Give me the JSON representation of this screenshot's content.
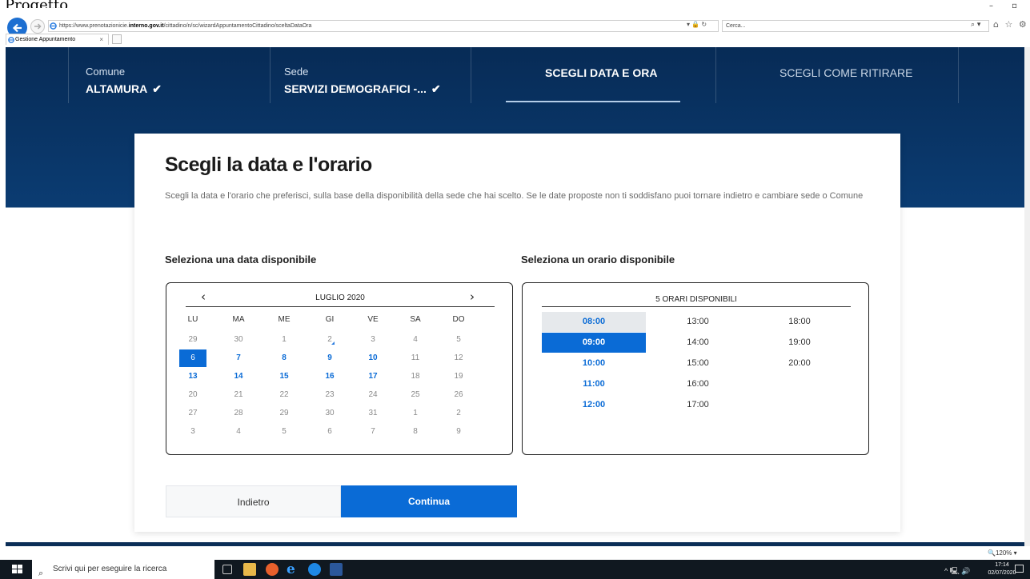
{
  "browser": {
    "top_text": "Progetto",
    "url_prefix": "https://www.prenotazionicie.",
    "url_domain": "interno.gov.it",
    "url_rest": "/cittadino/n/sc/wizardAppuntamentoCittadino/sceltaDataOra",
    "addr_icons": "▾ 🔒 ↻",
    "search_placeholder": "Cerca...",
    "search_icon_glyph": "⌕ ▾",
    "toolbar_glyphs": "⌂ ☆ ⚙ ☺",
    "window_controls": "– ▫ ×",
    "tab_title": "Gestione Appuntamento",
    "tab_close": "×"
  },
  "steps": {
    "comune_label": "Comune",
    "comune_value": "ALTAMURA",
    "sede_label": "Sede",
    "sede_value": "SERVIZI DEMOGRAFICI -...",
    "check": "✔",
    "active": "SCEGLI DATA E ORA",
    "next": "SCEGLI COME RITIRARE"
  },
  "card": {
    "title": "Scegli la data e l'orario",
    "description": "Scegli la data e l'orario che preferisci, sulla base della disponibilità della sede che hai scelto. Se le date proposte non ti soddisfano puoi tornare indietro e cambiare sede o Comune",
    "date_heading": "Seleziona una data disponibile",
    "time_heading": "Seleziona un orario disponibile"
  },
  "calendar": {
    "month": "LUGLIO 2020",
    "prev": "‹",
    "next": "›",
    "weekdays": [
      "LU",
      "MA",
      "ME",
      "GI",
      "VE",
      "SA",
      "DO"
    ],
    "weeks": [
      [
        "29",
        "30",
        "1",
        "2",
        "3",
        "4",
        "5"
      ],
      [
        "6",
        "7",
        "8",
        "9",
        "10",
        "11",
        "12"
      ],
      [
        "13",
        "14",
        "15",
        "16",
        "17",
        "18",
        "19"
      ],
      [
        "20",
        "21",
        "22",
        "23",
        "24",
        "25",
        "26"
      ],
      [
        "27",
        "28",
        "29",
        "30",
        "31",
        "1",
        "2"
      ],
      [
        "3",
        "4",
        "5",
        "6",
        "7",
        "8",
        "9"
      ]
    ],
    "available": [
      "6",
      "7",
      "8",
      "9",
      "10",
      "13",
      "14",
      "15",
      "16",
      "17"
    ],
    "selected": "6",
    "today": "2"
  },
  "times": {
    "header": "5 ORARI DISPONIBILI",
    "columns": [
      [
        "08:00",
        "09:00",
        "10:00",
        "11:00",
        "12:00"
      ],
      [
        "13:00",
        "14:00",
        "15:00",
        "16:00",
        "17:00"
      ],
      [
        "18:00",
        "19:00",
        "20:00"
      ]
    ],
    "available": [
      "08:00",
      "09:00",
      "10:00",
      "11:00",
      "12:00"
    ],
    "selected": "09:00",
    "hovered": "08:00"
  },
  "buttons": {
    "back": "Indietro",
    "next": "Continua"
  },
  "status": {
    "zoom": "🔍120% ▾"
  },
  "taskbar": {
    "search_placeholder": "Scrivi qui per eseguire la ricerca",
    "tray": "^ 🖳 🔊",
    "time": "17:14",
    "date": "02/07/2020"
  }
}
